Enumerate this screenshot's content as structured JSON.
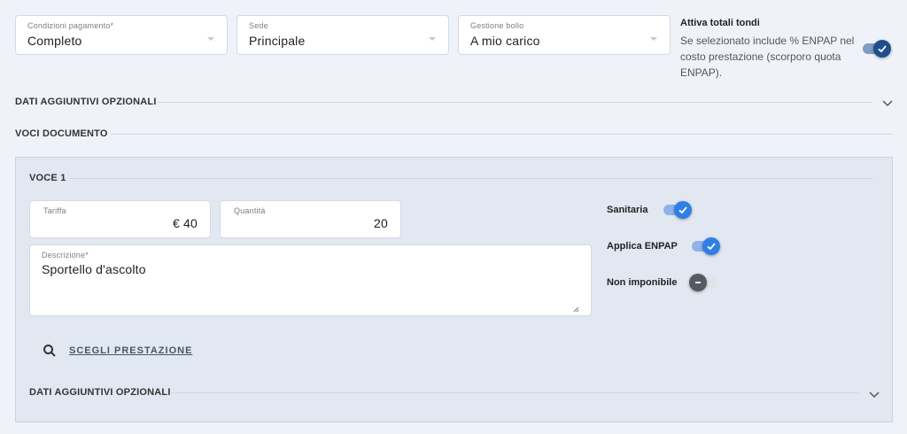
{
  "payment": {
    "label": "Condizioni pagamento*",
    "value": "Completo"
  },
  "office": {
    "label": "Sede",
    "value": "Principale"
  },
  "stamp": {
    "label": "Gestione bollo",
    "value": "A mio carico"
  },
  "round_totals": {
    "title": "Attiva totali tondi",
    "description": "Se selezionato include % ENPAP nel costo prestazione (scorporo quota ENPAP).",
    "enabled": true
  },
  "optional_data_label": "DATI AGGIUNTIVI OPZIONALI",
  "items_section_label": "VOCI DOCUMENTO",
  "item": {
    "title": "VOCE 1",
    "rate": {
      "label": "Tariffa",
      "value": "€ 40"
    },
    "quantity": {
      "label": "Quantità",
      "value": "20"
    },
    "description": {
      "label": "Descrizione*",
      "value": "Sportello d'ascolto"
    },
    "toggles": [
      {
        "label": "Sanitaria",
        "enabled": true
      },
      {
        "label": "Applica ENPAP",
        "enabled": true
      },
      {
        "label": "Non imponibile",
        "enabled": false
      }
    ],
    "choose_service_label": "SCEGLI PRESTAZIONE",
    "optional_data_label": "DATI AGGIUNTIVI OPZIONALI"
  },
  "colors": {
    "accent": "#2f7fe6",
    "background": "#eff3f9",
    "panel": "#e2e8f2"
  }
}
